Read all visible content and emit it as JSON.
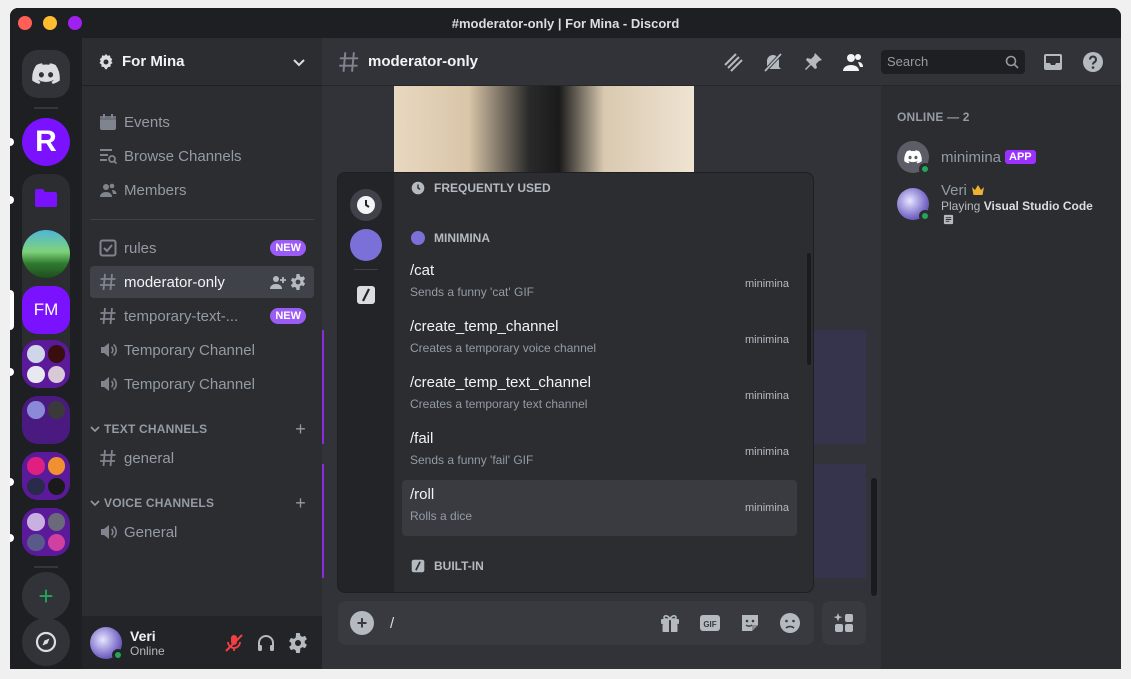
{
  "window": {
    "title": "#moderator-only | For Mina - Discord"
  },
  "rail": {
    "servers": [
      {
        "name": "home",
        "initials": ""
      },
      {
        "name": "R",
        "initials": "R"
      },
      {
        "name": "folder",
        "initials": ""
      },
      {
        "name": "landscape",
        "initials": ""
      },
      {
        "name": "For Mina",
        "initials": "FM"
      }
    ],
    "add_label": "+",
    "colors": {
      "accent": "#7a12ff",
      "rail_bg": "#1e1f22"
    }
  },
  "sidebar": {
    "server_name": "For Mina",
    "top_items": [
      {
        "label": "Events",
        "icon": "calendar-icon"
      },
      {
        "label": "Browse Channels",
        "icon": "browse-icon"
      },
      {
        "label": "Members",
        "icon": "members-icon"
      }
    ],
    "channels": [
      {
        "label": "rules",
        "icon": "rules-icon",
        "badge": "NEW"
      },
      {
        "label": "moderator-only",
        "icon": "hash-icon",
        "active": true
      },
      {
        "label": "temporary-text-...",
        "icon": "hash-icon",
        "badge": "NEW"
      },
      {
        "label": "Temporary Channel",
        "icon": "speaker-icon"
      },
      {
        "label": "Temporary Channel",
        "icon": "speaker-icon"
      }
    ],
    "categories": [
      {
        "label": "TEXT CHANNELS",
        "channels": [
          {
            "label": "general",
            "icon": "hash-icon"
          }
        ]
      },
      {
        "label": "VOICE CHANNELS",
        "channels": [
          {
            "label": "General",
            "icon": "speaker-icon"
          }
        ]
      }
    ]
  },
  "userbar": {
    "name": "Veri",
    "status": "Online"
  },
  "header": {
    "channel": "moderator-only",
    "search_placeholder": "Search"
  },
  "autocomplete": {
    "sections": {
      "frequent": "FREQUENTLY USED",
      "app": "MINIMINA",
      "builtin": "BUILT-IN"
    },
    "commands": [
      {
        "name": "/cat",
        "desc": "Sends a funny 'cat' GIF",
        "source": "minimina"
      },
      {
        "name": "/create_temp_channel",
        "desc": "Creates a temporary voice channel",
        "source": "minimina"
      },
      {
        "name": "/create_temp_text_channel",
        "desc": "Creates a temporary text channel",
        "source": "minimina"
      },
      {
        "name": "/fail",
        "desc": "Sends a funny 'fail' GIF",
        "source": "minimina"
      },
      {
        "name": "/roll",
        "desc": "Rolls a dice",
        "source": "minimina",
        "selected": true
      }
    ]
  },
  "composer": {
    "value": "/"
  },
  "members": {
    "heading": "ONLINE — 2",
    "list": [
      {
        "name": "minimina",
        "badge": "APP",
        "activity_prefix": "",
        "activity": ""
      },
      {
        "name": "Veri",
        "badge": "",
        "activity_prefix": "Playing ",
        "activity": "Visual Studio Code"
      }
    ]
  }
}
